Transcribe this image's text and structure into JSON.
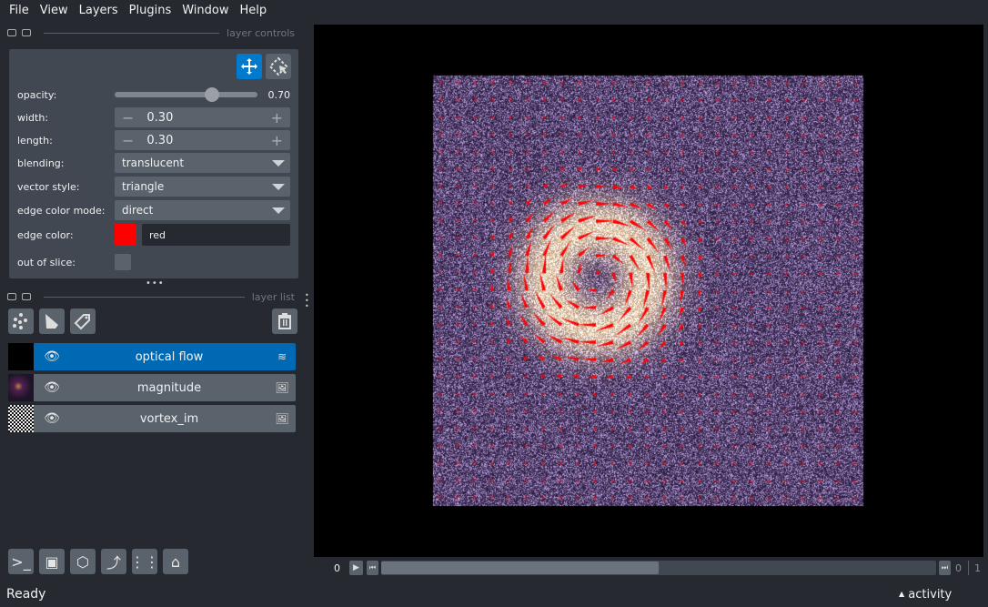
{
  "menu": [
    "File",
    "View",
    "Layers",
    "Plugins",
    "Window",
    "Help"
  ],
  "layer_controls": {
    "title": "layer controls",
    "opacity_label": "opacity:",
    "opacity": "0.70",
    "opacity_value": 0.7,
    "width_label": "width:",
    "width": "0.30",
    "length_label": "length:",
    "length": "0.30",
    "blending_label": "blending:",
    "blending": "translucent",
    "vector_style_label": "vector style:",
    "vector_style": "triangle",
    "edge_color_mode_label": "edge color mode:",
    "edge_color_mode": "direct",
    "edge_color_label": "edge color:",
    "edge_color": "red",
    "edge_color_hex": "#ff0000",
    "out_of_slice_label": "out of slice:"
  },
  "layer_list": {
    "title": "layer list",
    "layers": [
      {
        "name": "optical flow",
        "type": "vectors",
        "selected": true
      },
      {
        "name": "magnitude",
        "type": "image"
      },
      {
        "name": "vortex_im",
        "type": "image"
      }
    ]
  },
  "dims": {
    "current": "0",
    "left": "0",
    "right": "1",
    "slider_fraction": 0.5
  },
  "status": "Ready",
  "activity": "activity",
  "colors": {
    "accent": "#0069b3",
    "background": "#262930",
    "panel": "#414851"
  }
}
